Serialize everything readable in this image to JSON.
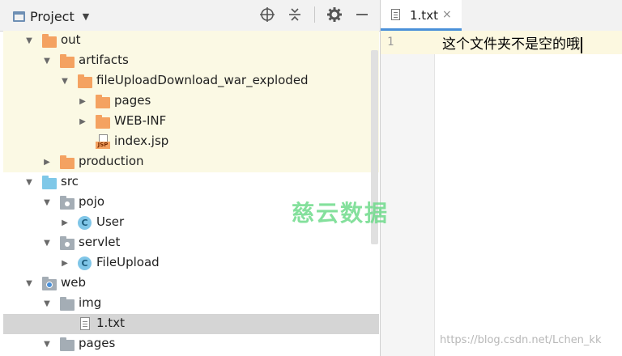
{
  "project_panel": {
    "title": "Project",
    "toolbar_icons": [
      "crosshair-icon",
      "collapse-all-icon",
      "gear-icon",
      "minimize-icon"
    ]
  },
  "tree": [
    {
      "label": "out",
      "depth": 0,
      "expanded": true,
      "icon": "folder-orange-icon",
      "highlight": "out"
    },
    {
      "label": "artifacts",
      "depth": 1,
      "expanded": true,
      "icon": "folder-orange-icon",
      "highlight": "out"
    },
    {
      "label": "fileUploadDownload_war_exploded",
      "depth": 2,
      "expanded": true,
      "icon": "folder-orange-icon",
      "highlight": "out"
    },
    {
      "label": "pages",
      "depth": 3,
      "expanded": false,
      "icon": "folder-orange-icon",
      "highlight": "out"
    },
    {
      "label": "WEB-INF",
      "depth": 3,
      "expanded": false,
      "icon": "folder-orange-icon",
      "highlight": "out"
    },
    {
      "label": "index.jsp",
      "depth": 3,
      "leaf": true,
      "icon": "jsp-file-icon",
      "highlight": "out"
    },
    {
      "label": "production",
      "depth": 1,
      "expanded": false,
      "icon": "folder-orange-icon",
      "highlight": "out"
    },
    {
      "label": "src",
      "depth": 0,
      "expanded": true,
      "icon": "source-folder-icon"
    },
    {
      "label": "pojo",
      "depth": 1,
      "expanded": true,
      "icon": "package-icon"
    },
    {
      "label": "User",
      "depth": 2,
      "expanded": false,
      "icon": "java-class-icon"
    },
    {
      "label": "servlet",
      "depth": 1,
      "expanded": true,
      "icon": "package-icon"
    },
    {
      "label": "FileUpload",
      "depth": 2,
      "expanded": false,
      "icon": "java-class-icon"
    },
    {
      "label": "web",
      "depth": 0,
      "expanded": true,
      "icon": "web-folder-icon"
    },
    {
      "label": "img",
      "depth": 1,
      "expanded": true,
      "icon": "folder-gray-icon"
    },
    {
      "label": "1.txt",
      "depth": 2,
      "leaf": true,
      "icon": "text-file-icon",
      "highlight": "selected"
    },
    {
      "label": "pages",
      "depth": 1,
      "expanded": true,
      "icon": "folder-gray-icon"
    }
  ],
  "editor": {
    "tab_label": "1.txt",
    "tab_close": "×",
    "line_number": "1",
    "line_text": "这个文件夹不是空的哦"
  },
  "watermark": "慈云数据",
  "credit": "https://blog.csdn.net/Lchen_kk",
  "colors": {
    "out_highlight": "#fbf9e4",
    "selection": "#d5d5d5",
    "folder_orange": "#f4a261",
    "folder_blue": "#7fc8e8",
    "folder_gray": "#a4adb5",
    "watermark_green": "#6fdb8b"
  }
}
